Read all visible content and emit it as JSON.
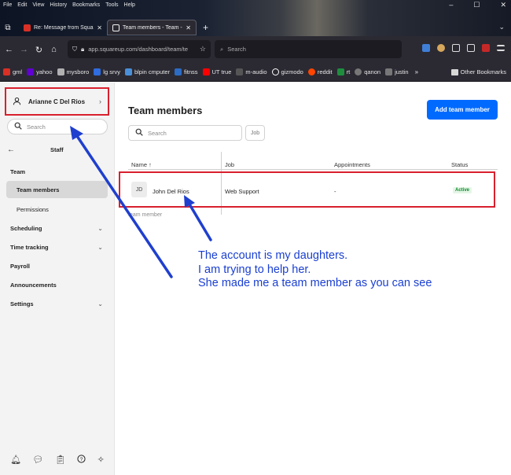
{
  "browser": {
    "menu": [
      "File",
      "Edit",
      "View",
      "History",
      "Bookmarks",
      "Tools",
      "Help"
    ],
    "window_controls": [
      "–",
      "☐",
      "✕"
    ],
    "tabs": [
      {
        "title": "Re: Message from Square Suppo",
        "favicon": "gmail-icon",
        "color": "#d93025"
      },
      {
        "title": "Team members - Team - Staff | Sq",
        "favicon": "square-icon",
        "color": "#f2f2f2"
      }
    ],
    "url": "app.squareup.com/dashboard/team/te",
    "search_placeholder": "Search",
    "bookmarks": [
      {
        "label": "gml",
        "color": "#d93025"
      },
      {
        "label": "yahoo",
        "color": "#6001d2"
      },
      {
        "label": "mysboro",
        "color": "#b0b0b0"
      },
      {
        "label": "lg srvy",
        "color": "#2f6de0"
      },
      {
        "label": "blpin cmputer",
        "color": "#4a90d9"
      },
      {
        "label": "fitnss",
        "color": "#2c6cc4"
      },
      {
        "label": "UT true",
        "color": "#ff0000"
      },
      {
        "label": "m-audio",
        "color": "#cccccc"
      },
      {
        "label": "gizmodo",
        "color": "#ffffff"
      },
      {
        "label": "reddit",
        "color": "#ff4500"
      },
      {
        "label": "rt",
        "color": "#1e8e3e"
      },
      {
        "label": "qanon",
        "color": "#cccccc"
      },
      {
        "label": "justin",
        "color": "#cccccc"
      }
    ],
    "other_bookmarks": "Other Bookmarks"
  },
  "sidebar": {
    "account_name": "Arianne C Del Rios",
    "search_placeholder": "Search",
    "section_title": "Staff",
    "items": [
      {
        "label": "Team",
        "type": "header"
      },
      {
        "label": "Team members",
        "type": "sub",
        "active": true
      },
      {
        "label": "Permissions",
        "type": "sub"
      },
      {
        "label": "Scheduling",
        "type": "group"
      },
      {
        "label": "Time tracking",
        "type": "group"
      },
      {
        "label": "Payroll",
        "type": "header"
      },
      {
        "label": "Announcements",
        "type": "header"
      },
      {
        "label": "Settings",
        "type": "group"
      }
    ]
  },
  "main": {
    "title": "Team members",
    "add_button": "Add team member",
    "search_placeholder": "Search",
    "job_filter": "Job",
    "columns": [
      "Name ↑",
      "Job",
      "Appointments",
      "Status"
    ],
    "rows": [
      {
        "initials": "JD",
        "name": "John Del Rios",
        "job": "Web Support",
        "appointments": "-",
        "status": "Active"
      }
    ],
    "row_hint": "team member"
  },
  "annotation": {
    "lines": [
      "The account is my daughters.",
      "I am trying to help her.",
      "She made me a team member as you can see"
    ],
    "color": "#1a3fd1"
  },
  "colors": {
    "brand_blue": "#006aff",
    "highlight_red": "#d9202e"
  }
}
